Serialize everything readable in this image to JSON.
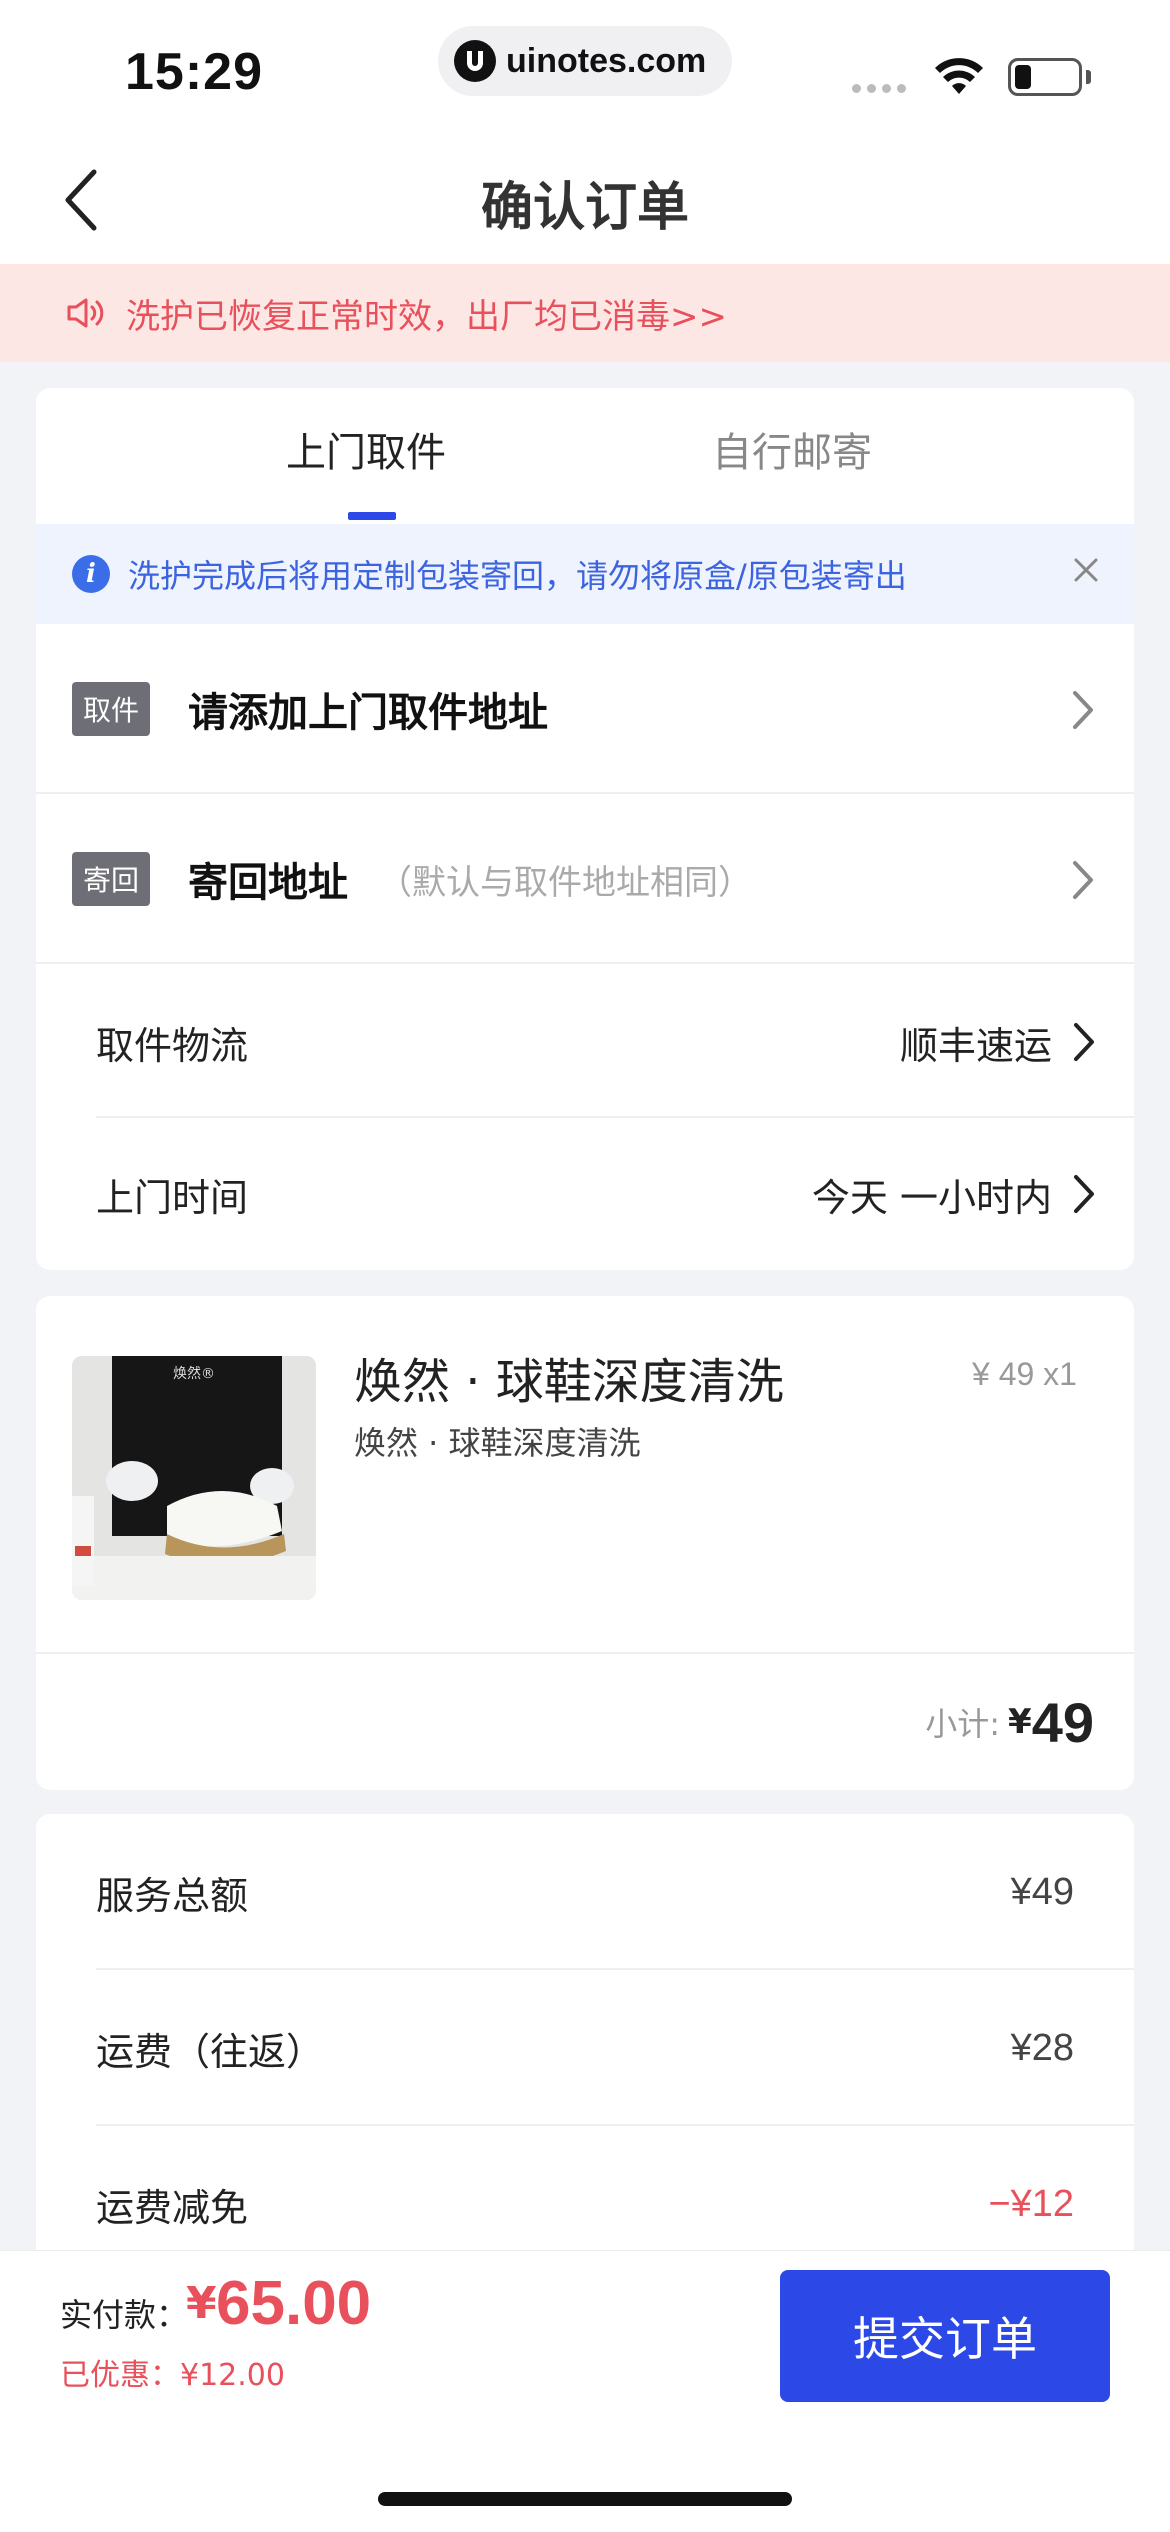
{
  "status_bar": {
    "time": "15:29",
    "url": "uinotes.com"
  },
  "header": {
    "title": "确认订单"
  },
  "notice": {
    "text": "洗护已恢复正常时效，出厂均已消毒>>"
  },
  "tabs": [
    {
      "label": "上门取件",
      "active": true
    },
    {
      "label": "自行邮寄",
      "active": false
    }
  ],
  "info_bar": {
    "text": "洗护完成后将用定制包装寄回，请勿将原盒/原包装寄出"
  },
  "pickup_address": {
    "tag": "取件",
    "title": "请添加上门取件地址"
  },
  "return_address": {
    "tag": "寄回",
    "title": "寄回地址",
    "hint": "（默认与取件地址相同）"
  },
  "logistics": {
    "label": "取件物流",
    "value": "顺丰速运"
  },
  "pickup_time": {
    "label": "上门时间",
    "value": "今天 一小时内"
  },
  "product": {
    "title": "焕然 · 球鞋深度清洗",
    "subtitle": "焕然 · 球鞋深度清洗",
    "price": "¥ 49 x1",
    "image_brand": "焕然®"
  },
  "subtotal": {
    "label": "小计:",
    "currency": "¥",
    "value": "49"
  },
  "fees": [
    {
      "label": "服务总额",
      "value": "¥49",
      "negative": false
    },
    {
      "label": "运费（往返）",
      "value": "¥28",
      "negative": false
    },
    {
      "label": "运费减免",
      "value": "−¥12",
      "negative": true
    }
  ],
  "footer": {
    "pay_label": "实付款：",
    "currency": "¥",
    "amount": "65.00",
    "discount": "已优惠：¥12.00",
    "submit": "提交订单"
  },
  "colors": {
    "accent": "#2c49e8",
    "alert": "#e8505b",
    "notice_bg": "#fde7e4",
    "info_bg": "#eef3fd"
  }
}
